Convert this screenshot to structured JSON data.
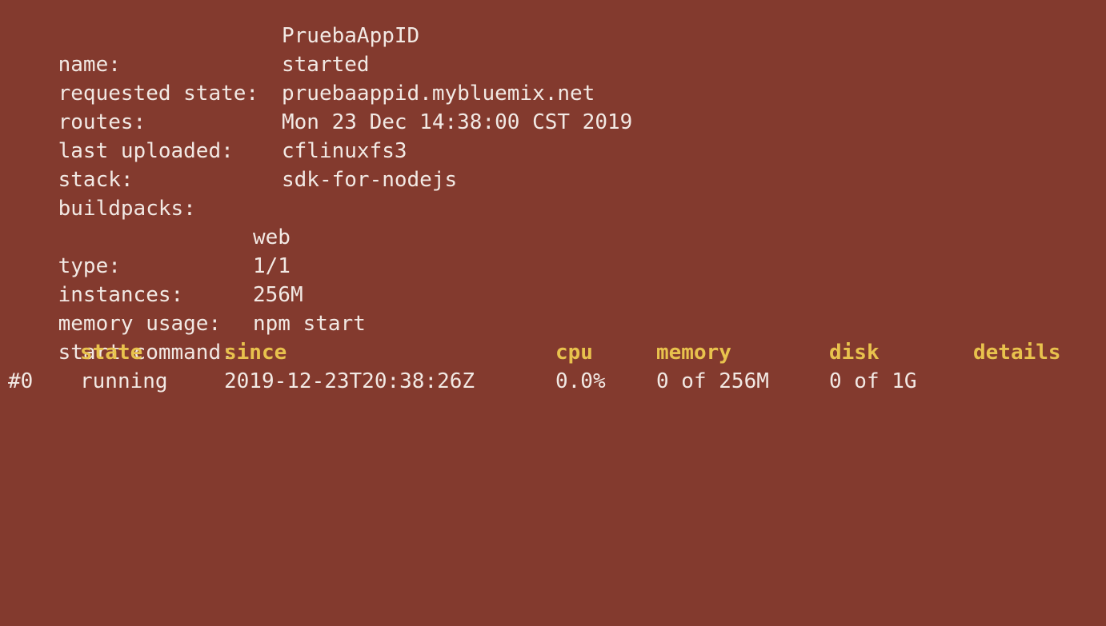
{
  "app_info": [
    {
      "key": "name:",
      "value": "PruebaAppID"
    },
    {
      "key": "requested state:",
      "value": "started"
    },
    {
      "key": "routes:",
      "value": "pruebaappid.mybluemix.net"
    },
    {
      "key": "last uploaded:",
      "value": "Mon 23 Dec 14:38:00 CST 2019"
    },
    {
      "key": "stack:",
      "value": "cflinuxfs3"
    },
    {
      "key": "buildpacks:",
      "value": "sdk-for-nodejs"
    }
  ],
  "process_info": [
    {
      "key": "type:",
      "value": "web"
    },
    {
      "key": "instances:",
      "value": "1/1"
    },
    {
      "key": "memory usage:",
      "value": "256M"
    },
    {
      "key": "start command:",
      "value": "npm start"
    }
  ],
  "instances_table": {
    "headers": [
      "state",
      "since",
      "cpu",
      "memory",
      "disk",
      "details"
    ],
    "rows": [
      {
        "index": "#0",
        "state": "running",
        "since": "2019-12-23T20:38:26Z",
        "cpu": "0.0%",
        "memory": "0 of 256M",
        "disk": "0 of 1G",
        "details": ""
      }
    ]
  },
  "colors": {
    "background": "#833a2e",
    "text": "#f2e9e4",
    "header": "#e8c24d"
  }
}
